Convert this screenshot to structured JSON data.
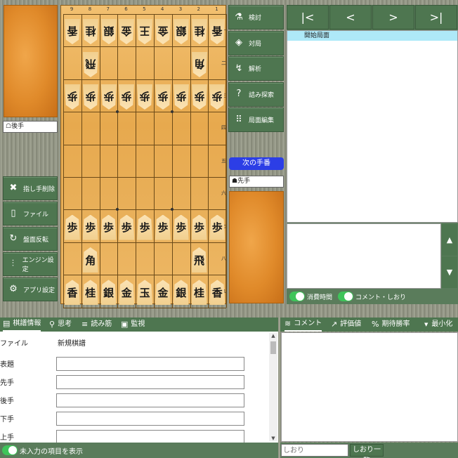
{
  "gote_name": "☖後手",
  "sente_name": "☗先手",
  "next_turn_label": "次の手番",
  "left_buttons": [
    {
      "label": "指し手削除",
      "icon": "delete-icon"
    },
    {
      "label": "ファイル",
      "icon": "file-icon"
    },
    {
      "label": "盤面反転",
      "icon": "flip-icon"
    },
    {
      "label": "エンジン設定",
      "icon": "sliders-icon"
    },
    {
      "label": "アプリ設定",
      "icon": "gear-icon"
    }
  ],
  "right_buttons": [
    {
      "label": "検討",
      "icon": "flask-icon"
    },
    {
      "label": "対局",
      "icon": "gamepad-icon"
    },
    {
      "label": "解析",
      "icon": "analysis-icon"
    },
    {
      "label": "詰み探索",
      "icon": "question-icon"
    },
    {
      "label": "局面編集",
      "icon": "edit-board-icon"
    }
  ],
  "file_coords": [
    "9",
    "8",
    "7",
    "6",
    "5",
    "4",
    "3",
    "2",
    "1"
  ],
  "rank_coords": [
    "一",
    "二",
    "三",
    "四",
    "五",
    "六",
    "七",
    "八",
    "九"
  ],
  "pieces": [
    {
      "r": 0,
      "f": 0,
      "c": "香",
      "g": true
    },
    {
      "r": 0,
      "f": 1,
      "c": "桂",
      "g": true
    },
    {
      "r": 0,
      "f": 2,
      "c": "銀",
      "g": true
    },
    {
      "r": 0,
      "f": 3,
      "c": "金",
      "g": true
    },
    {
      "r": 0,
      "f": 4,
      "c": "王",
      "g": true
    },
    {
      "r": 0,
      "f": 5,
      "c": "金",
      "g": true
    },
    {
      "r": 0,
      "f": 6,
      "c": "銀",
      "g": true
    },
    {
      "r": 0,
      "f": 7,
      "c": "桂",
      "g": true
    },
    {
      "r": 0,
      "f": 8,
      "c": "香",
      "g": true
    },
    {
      "r": 1,
      "f": 1,
      "c": "飛",
      "g": true
    },
    {
      "r": 1,
      "f": 7,
      "c": "角",
      "g": true
    },
    {
      "r": 2,
      "f": 0,
      "c": "歩",
      "g": true
    },
    {
      "r": 2,
      "f": 1,
      "c": "歩",
      "g": true
    },
    {
      "r": 2,
      "f": 2,
      "c": "歩",
      "g": true
    },
    {
      "r": 2,
      "f": 3,
      "c": "歩",
      "g": true
    },
    {
      "r": 2,
      "f": 4,
      "c": "歩",
      "g": true
    },
    {
      "r": 2,
      "f": 5,
      "c": "歩",
      "g": true
    },
    {
      "r": 2,
      "f": 6,
      "c": "歩",
      "g": true
    },
    {
      "r": 2,
      "f": 7,
      "c": "歩",
      "g": true
    },
    {
      "r": 2,
      "f": 8,
      "c": "歩",
      "g": true
    },
    {
      "r": 6,
      "f": 0,
      "c": "歩",
      "g": false
    },
    {
      "r": 6,
      "f": 1,
      "c": "歩",
      "g": false
    },
    {
      "r": 6,
      "f": 2,
      "c": "歩",
      "g": false
    },
    {
      "r": 6,
      "f": 3,
      "c": "歩",
      "g": false
    },
    {
      "r": 6,
      "f": 4,
      "c": "歩",
      "g": false
    },
    {
      "r": 6,
      "f": 5,
      "c": "歩",
      "g": false
    },
    {
      "r": 6,
      "f": 6,
      "c": "歩",
      "g": false
    },
    {
      "r": 6,
      "f": 7,
      "c": "歩",
      "g": false
    },
    {
      "r": 6,
      "f": 8,
      "c": "歩",
      "g": false
    },
    {
      "r": 7,
      "f": 1,
      "c": "角",
      "g": false
    },
    {
      "r": 7,
      "f": 7,
      "c": "飛",
      "g": false
    },
    {
      "r": 8,
      "f": 0,
      "c": "香",
      "g": false
    },
    {
      "r": 8,
      "f": 1,
      "c": "桂",
      "g": false
    },
    {
      "r": 8,
      "f": 2,
      "c": "銀",
      "g": false
    },
    {
      "r": 8,
      "f": 3,
      "c": "金",
      "g": false
    },
    {
      "r": 8,
      "f": 4,
      "c": "玉",
      "g": false
    },
    {
      "r": 8,
      "f": 5,
      "c": "金",
      "g": false
    },
    {
      "r": 8,
      "f": 6,
      "c": "銀",
      "g": false
    },
    {
      "r": 8,
      "f": 7,
      "c": "桂",
      "g": false
    },
    {
      "r": 8,
      "f": 8,
      "c": "香",
      "g": false
    }
  ],
  "nav_buttons": [
    "|<",
    "<",
    ">",
    ">|"
  ],
  "record_first_move": "開始局面",
  "toggles": {
    "time": "消費時間",
    "comment": "コメント・しおり"
  },
  "bottom_tabs": [
    {
      "label": "棋譜情報",
      "icon": "document-icon"
    },
    {
      "label": "思考",
      "icon": "pin-icon"
    },
    {
      "label": "読み筋",
      "icon": "search-lines-icon"
    },
    {
      "label": "監視",
      "icon": "monitor-icon"
    }
  ],
  "right_tabs": [
    {
      "label": "コメント",
      "icon": "comment-icon"
    },
    {
      "label": "評価値",
      "icon": "chart-icon"
    },
    {
      "label": "期待勝率",
      "icon": "percent-icon"
    }
  ],
  "minimize_label": "最小化",
  "fields": [
    {
      "label": "ファイル",
      "value": "新規棋譜",
      "is_text": true
    },
    {
      "label": "表題",
      "value": ""
    },
    {
      "label": "先手",
      "value": ""
    },
    {
      "label": "後手",
      "value": ""
    },
    {
      "label": "下手",
      "value": ""
    },
    {
      "label": "上手",
      "value": ""
    }
  ],
  "show_empty_label": "未入力の項目を表示",
  "bookmark_placeholder": "しおり",
  "bookmark_list_label": "しおり一覧"
}
